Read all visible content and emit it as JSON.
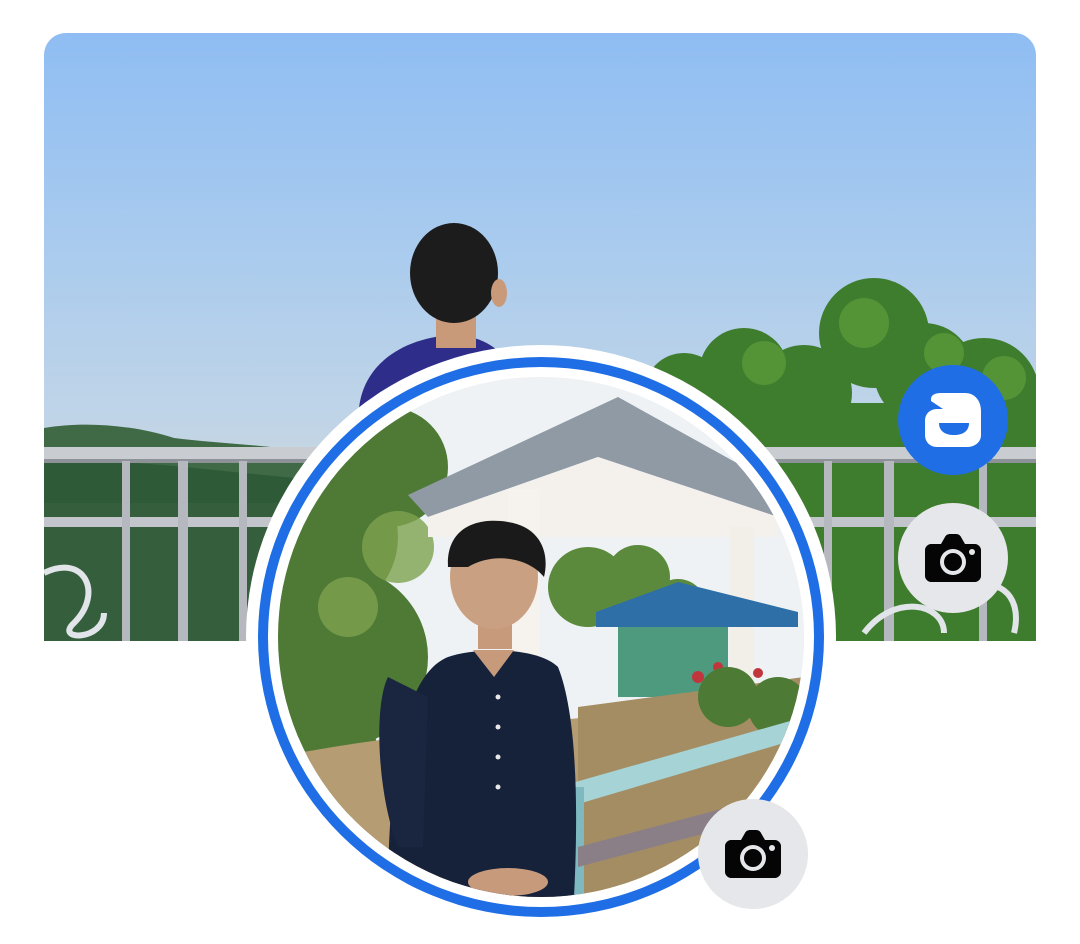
{
  "profile_header": {
    "cover_photo": {
      "description_icon": "landscape-photo"
    },
    "profile_picture": {
      "description_icon": "profile-photo"
    },
    "buttons": {
      "avatar": {
        "icon": "avatar-icon"
      },
      "edit_cover": {
        "icon": "camera-icon"
      },
      "edit_profile_picture": {
        "icon": "camera-icon"
      }
    }
  },
  "colors": {
    "accent": "#1f6ee6",
    "button_gray": "#e6e7ea",
    "icon_dark": "#050505",
    "background": "#ffffff"
  }
}
